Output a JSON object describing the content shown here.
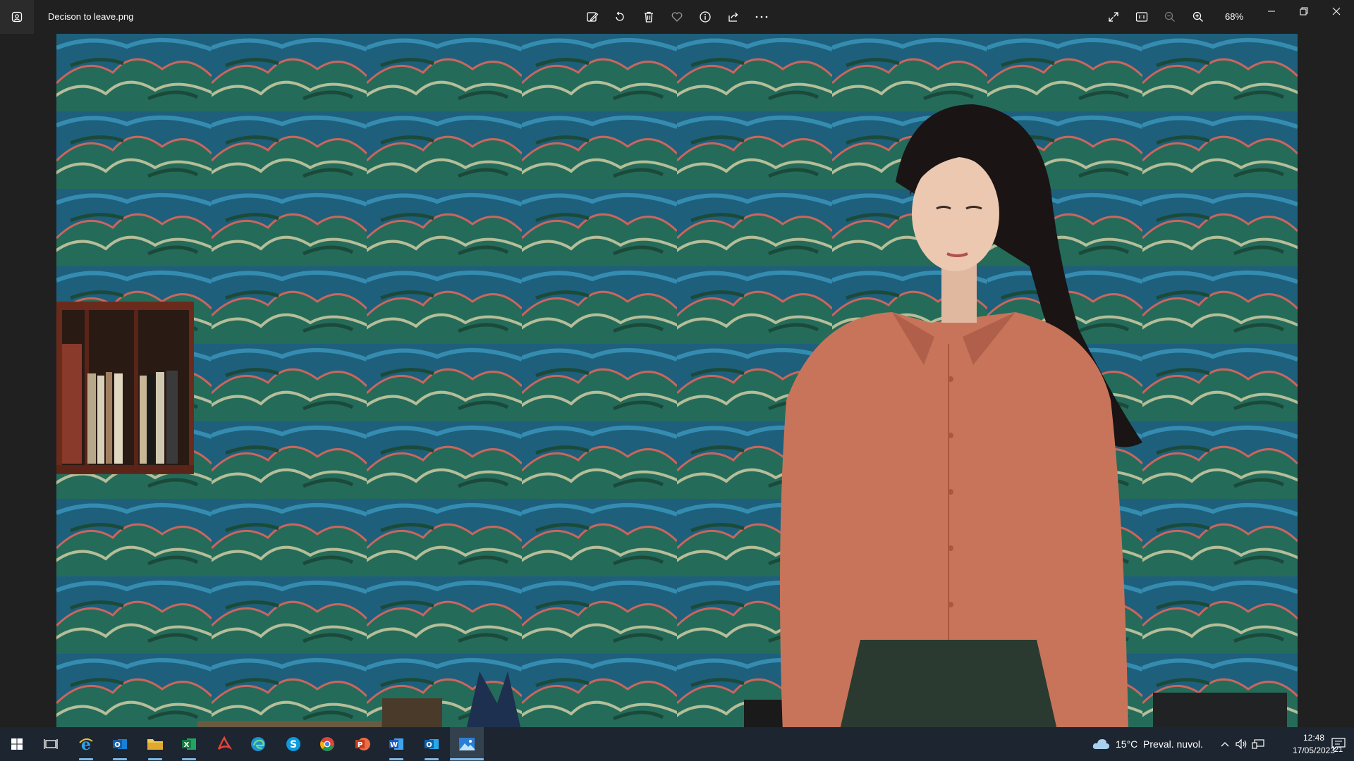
{
  "window": {
    "file_name": "Decison to leave.png",
    "zoom": "68%"
  },
  "toolbar": {
    "left_icons": [
      "edit-image-icon",
      "rotate-icon",
      "delete-icon",
      "favorite-icon",
      "info-icon",
      "share-icon",
      "more-icon"
    ],
    "right_icons": [
      "fullscreen-icon",
      "actual-size-icon",
      "zoom-out-icon",
      "zoom-in-icon"
    ],
    "window_controls": [
      "minimize-icon",
      "restore-icon",
      "close-icon"
    ]
  },
  "photo": {
    "alt_scene": "woman in orange shirt in front of blue mountain-pattern wallpaper",
    "colors": {
      "wallpaper": "#1f5f7a",
      "shirt": "#c8745a",
      "hair": "#1a1414"
    }
  },
  "taskbar": {
    "apps": [
      "start-icon",
      "task-view-icon",
      "internet-explorer-icon",
      "outlook-icon",
      "file-explorer-icon",
      "excel-icon",
      "acrobat-icon",
      "edge-icon",
      "skype-icon",
      "chrome-icon",
      "powerpoint-icon",
      "word-icon",
      "outlook-2-icon",
      "photos-icon"
    ],
    "weather_text": "15°C  Preval. nuvol.",
    "time": "12:48",
    "date": "17/05/2023",
    "notifications": "21",
    "colors": {
      "accent": "#7bb7e8",
      "bg": "#1c2530"
    }
  }
}
